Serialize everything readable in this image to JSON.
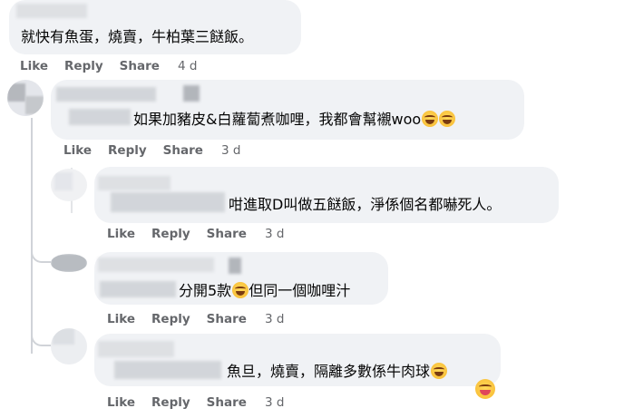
{
  "comments": [
    {
      "text": "就快有魚蛋，燒賣，牛柏葉三餸飯。",
      "actions": {
        "like": "Like",
        "reply": "Reply",
        "share": "Share",
        "time": "4 d"
      }
    },
    {
      "text": "如果加豬皮&白蘿蔔煮咖哩，我都會幫襯woo",
      "emoji": [
        "rolling-on-floor-laughing",
        "rolling-on-floor-laughing"
      ],
      "actions": {
        "like": "Like",
        "reply": "Reply",
        "share": "Share",
        "time": "3 d"
      }
    },
    {
      "text": "咁進取D叫做五餸飯，淨係個名都嚇死人。",
      "actions": {
        "like": "Like",
        "reply": "Reply",
        "share": "Share",
        "time": "3 d"
      }
    },
    {
      "text_before_emoji": "分開5款",
      "emoji": [
        "rolling-on-floor-laughing"
      ],
      "text_after_emoji": "但同一個咖哩汁",
      "actions": {
        "like": "Like",
        "reply": "Reply",
        "share": "Share",
        "time": "3 d"
      }
    },
    {
      "text": "魚旦，燒賣，隔離多數係牛肉球",
      "emoji": [
        "grinning-squinting-face",
        "squinting-face-with-tongue"
      ],
      "actions": {
        "like": "Like",
        "reply": "Reply",
        "share": "Share",
        "time": "3 d"
      }
    }
  ]
}
